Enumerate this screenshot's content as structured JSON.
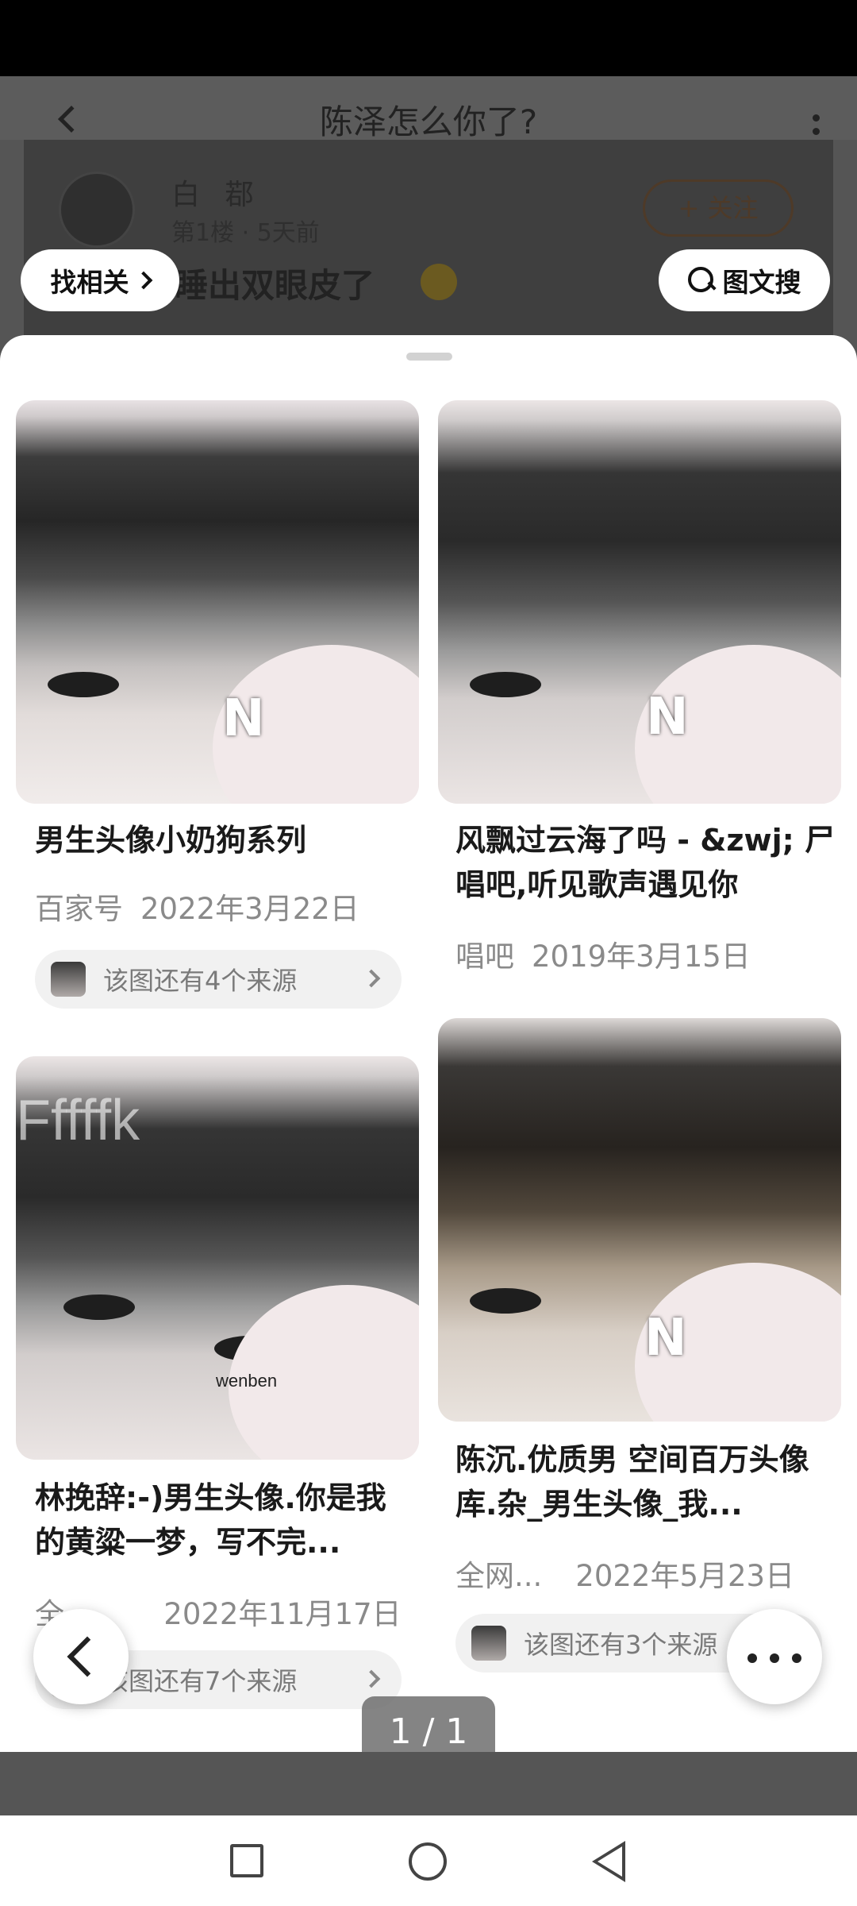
{
  "background_post": {
    "title": "陈泽怎么你了?",
    "author": "白 鄀",
    "meta": "第1楼 · 5天前",
    "follow_label": "+ 关注",
    "text": "睡出双眼皮了"
  },
  "top_actions": {
    "related_label": "找相关",
    "search_label": "图文搜"
  },
  "results": [
    {
      "title": "男生头像小奶狗系列",
      "source": "百家号",
      "date": "2022年3月22日",
      "more_sources": "该图还有4个来源",
      "watermark": "N"
    },
    {
      "title": "风飘过云海了吗 - &zwj; 尸 唱吧,听见歌声遇见你",
      "source": "唱吧",
      "date": "2019年3月15日",
      "watermark": "N"
    },
    {
      "title": "林挽辞:-)男生头像.你是我的黄粱一梦，写不完...",
      "source": "全...",
      "date": "2022年11月17日",
      "more_sources": "该图还有7个来源",
      "watermark_text": "Fffffk",
      "watermark_small": "wenben"
    },
    {
      "title": "陈沉.优质男 空间百万头像库.杂_男生头像_我...",
      "source": "全网...",
      "date": "2022年5月23日",
      "more_sources": "该图还有3个来源",
      "watermark": "N"
    }
  ],
  "page_indicator": "1 / 1",
  "colors": {
    "sheet_bg": "#ffffff",
    "dim_overlay": "#555555",
    "meta_text": "#8a8a8a",
    "source_pill_bg": "#f1f1f1"
  },
  "icons": [
    "chevron-right-icon",
    "search-icon",
    "back-icon",
    "more-icon",
    "nav-recents-icon",
    "nav-home-icon",
    "nav-back-icon"
  ]
}
